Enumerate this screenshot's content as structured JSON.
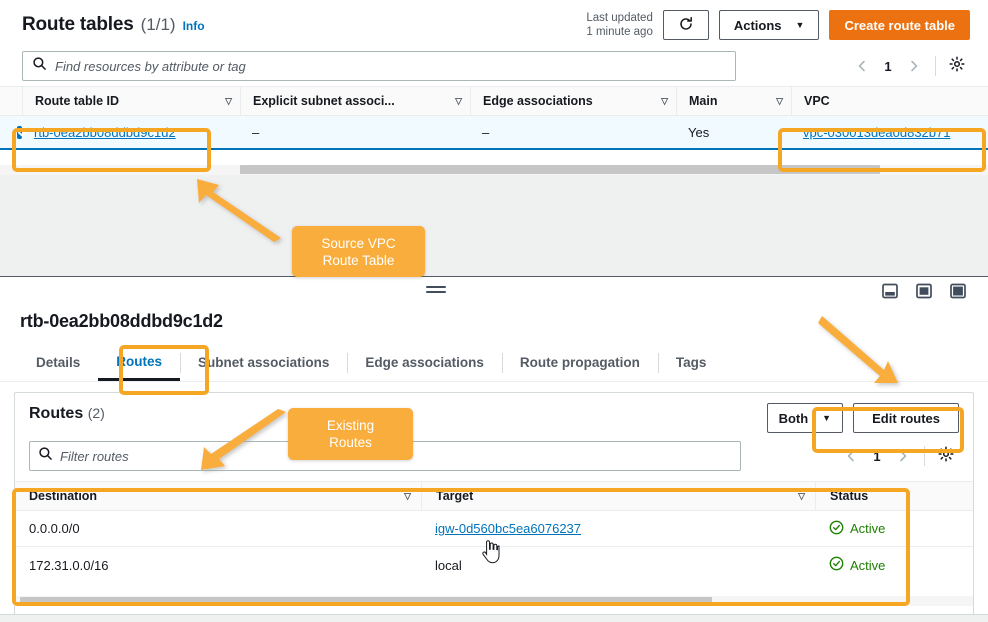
{
  "list_panel": {
    "title": "Route tables",
    "count": "(1/1)",
    "info_label": "Info",
    "last_updated_line1": "Last updated",
    "last_updated_line2": "1 minute ago",
    "refresh_icon": "refresh-icon",
    "actions_label": "Actions",
    "create_label": "Create route table",
    "search_placeholder": "Find resources by attribute or tag",
    "search_value": "",
    "page_number": "1",
    "columns": [
      "Route table ID",
      "Explicit subnet associ...",
      "Edge associations",
      "Main",
      "VPC"
    ],
    "rows": [
      {
        "selected": true,
        "route_table_id": "rtb-0ea2bb08ddbd9c1d2",
        "explicit_subnet_associations": "–",
        "edge_associations": "–",
        "main": "Yes",
        "vpc": "vpc-030013dea0d832b71"
      }
    ]
  },
  "detail_panel": {
    "title": "rtb-0ea2bb08ddbd9c1d2",
    "tabs": [
      {
        "label": "Details",
        "active": false
      },
      {
        "label": "Routes",
        "active": true
      },
      {
        "label": "Subnet associations",
        "active": false
      },
      {
        "label": "Edge associations",
        "active": false
      },
      {
        "label": "Route propagation",
        "active": false
      },
      {
        "label": "Tags",
        "active": false
      }
    ],
    "layout_icons": [
      "split-panel-bottom-icon",
      "split-panel-side-icon",
      "split-panel-full-icon"
    ],
    "routes": {
      "title": "Routes",
      "count": "(2)",
      "filter_placeholder": "Filter routes",
      "filter_value": "",
      "select_value": "Both",
      "edit_label": "Edit routes",
      "page_number": "1",
      "columns": [
        "Destination",
        "Target",
        "Status"
      ],
      "rows": [
        {
          "destination": "0.0.0.0/0",
          "target": "igw-0d560bc5ea6076237",
          "target_is_link": true,
          "status": "Active"
        },
        {
          "destination": "172.31.0.0/16",
          "target": "local",
          "target_is_link": false,
          "status": "Active"
        }
      ]
    }
  },
  "annotations": {
    "callouts": [
      {
        "id": "source-vpc-route-table",
        "line1": "Source VPC",
        "line2": "Route Table"
      },
      {
        "id": "existing-routes",
        "line1": "Existing",
        "line2": "Routes"
      }
    ],
    "highlight_color": "#f5a623",
    "callout_color": "#f9ad3c"
  }
}
